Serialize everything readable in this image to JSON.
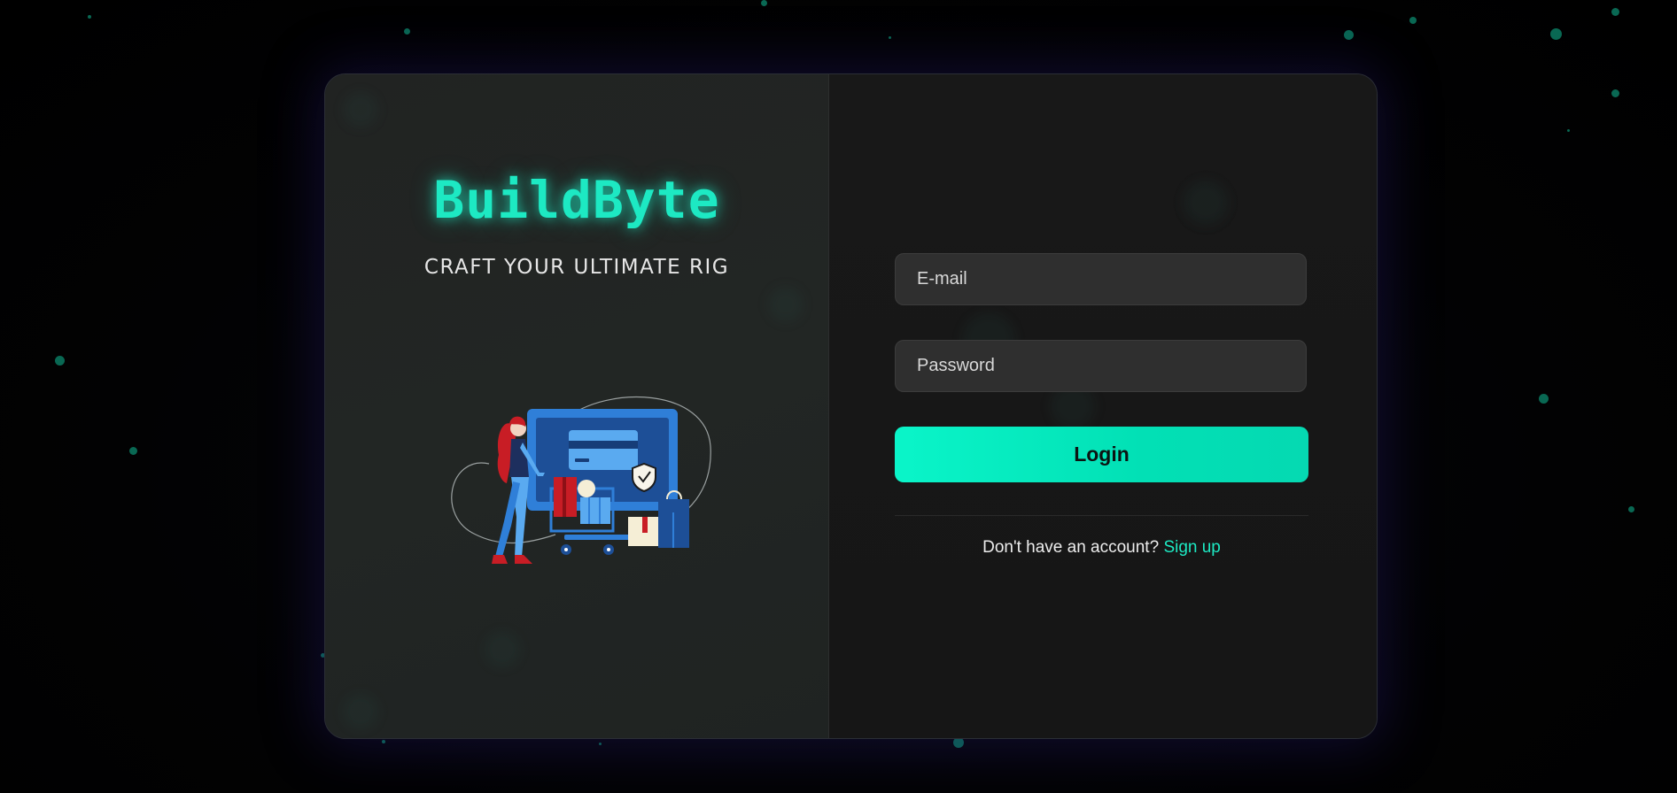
{
  "brand": {
    "title": "BuildByte",
    "tagline": "CRAFT YOUR ULTIMATE RIG",
    "accent_color": "#1de9c3"
  },
  "illustration": {
    "icon": "shopping-checkout-illustration"
  },
  "login_form": {
    "email_placeholder": "E-mail",
    "email_value": "",
    "password_placeholder": "Password",
    "password_value": "",
    "login_label": "Login",
    "signup_prompt": "Don't have an account?",
    "signup_link": "Sign up"
  },
  "colors": {
    "background": "#000000",
    "card": "#171717",
    "field": "#2f2f2f",
    "button": "#0af5c9",
    "particle": "#0b7a62"
  }
}
